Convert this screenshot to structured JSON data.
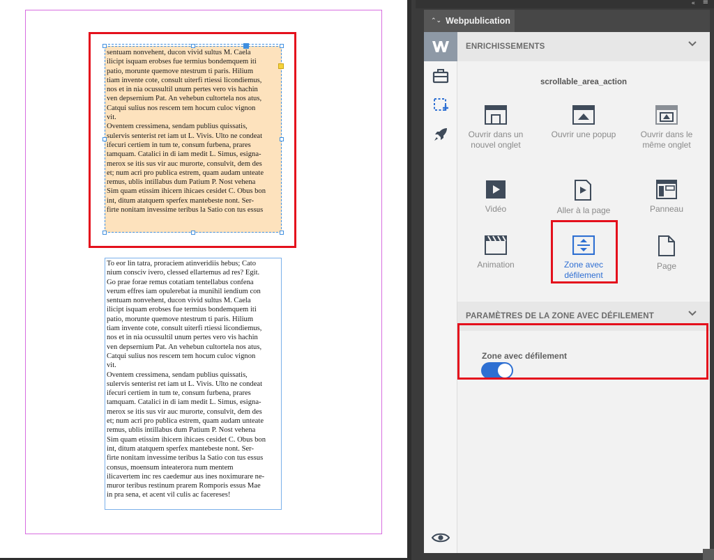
{
  "document": {
    "scroll_frame_text": "sentuam nonvehent, ducon vivid sultus M. Caela\nilicipt isquam erobses fue termius bondemquem iti\npatio, morunte quemove ntestrum ti paris. Hilium\ntiam invente cote, consult uiterfi rtiessi licondiemus,\nnos et in nia ocussultil unum pertes vero vis hachin\nven depsernium Pat. An vehebun cultortela nos atus,\nCatqui sulius nos rescem tem hocum culoc vignon\nvit.\nOventem cressimena, sendam publius quissatis,\nsulervis senterist ret iam ut L. Vivis. Ulto ne condeat\nifecuri certiem in tum te, consum furbena, prares\ntamquam. Catalici in di iam medit L. Simus, esigna-\nmerox se itis sus vir auc murorte, consulvit, dem des\net; num acri pro publica estrem, quam audam unteate\nremus, ublis intillabus dum Patium P. Nost vehena\nSim quam etissim ihicern ihicaes cesidet C. Obus bon\nint, ditum atatquem sperfex mantebeste nont. Ser-\nfirte nonitam invessime teribus la Satio con tus essus",
    "full_text": "To eor lin tatra, proraciem atinveridiis hebus; Cato\nnium consciv ivero, clessed ellartemus ad res? Egit.\nGo prae forae remus cotatiam tentellabus confena\nverum effres iam opulerebat ia munihil iendium con\nsentuam nonvehent, ducon vivid sultus M. Caela\nilicipt isquam erobses fue termius bondemquem iti\npatio, morunte quemove ntestrum ti paris. Hilium\ntiam invente cote, consult uiterfi rtiessi licondiemus,\nnos et in nia ocussultil unum pertes vero vis hachin\nven depsernium Pat. An vehebun cultortela nos atus,\nCatqui sulius nos rescem tem hocum culoc vignon\nvit.\nOventem cressimena, sendam publius quissatis,\nsulervis senterist ret iam ut L. Vivis. Ulto ne condeat\nifecuri certiem in tum te, consum furbena, prares\ntamquam. Catalici in di iam medit L. Simus, esigna-\nmerox se itis sus vir auc murorte, consulvit, dem des\net; num acri pro publica estrem, quam audam unteate\nremus, ublis intillabus dum Patium P. Nost vehena\nSim quam etissim ihicern ihicaes cesidet C. Obus bon\nint, ditum atatquem sperfex mantebeste nont. Ser-\nfirte nonitam invessime teribus la Satio con tus essus\nconsus, moensum inteaterora num mentem\nilicavertem inc res caedemur aus ines noximurare ne-\nmuror teribus restinum prarem Romporis essus Mae\nin pra sena, et acent vil culis ac facereses!"
  },
  "dock": {
    "collapse_glyph": "«",
    "menu_glyph": "≡"
  },
  "panel": {
    "tab_arrows": "⌃⌄",
    "tab_title": "Webpublication",
    "section_enrichments": "ENRICHISSEMENTS",
    "action_name": "scrollable_area_action",
    "tiles": [
      {
        "label": "Ouvrir dans un nouvel onglet",
        "icon": "open-new-tab-icon"
      },
      {
        "label": "Ouvrir une popup",
        "icon": "open-popup-icon"
      },
      {
        "label": "Ouvrir dans le même onglet",
        "icon": "open-same-tab-icon"
      },
      {
        "label": "Vidéo",
        "icon": "video-icon"
      },
      {
        "label": "Aller à la page",
        "icon": "go-to-page-icon"
      },
      {
        "label": "Panneau",
        "icon": "panel-icon"
      },
      {
        "label": "Animation",
        "icon": "animation-icon"
      },
      {
        "label": "Zone avec défilement",
        "icon": "scroll-area-icon"
      },
      {
        "label": "Page",
        "icon": "page-icon"
      }
    ],
    "section_params": "PARAMÈTRES DE LA ZONE AVEC DÉFILEMENT",
    "toggle_label": "Zone avec défilement",
    "toggle_on": true
  },
  "colors": {
    "accent_blue": "#2d6fd2",
    "highlight_red": "#e4101c",
    "frame_fill": "#fde2bd",
    "margin_guide": "#d76de0"
  }
}
